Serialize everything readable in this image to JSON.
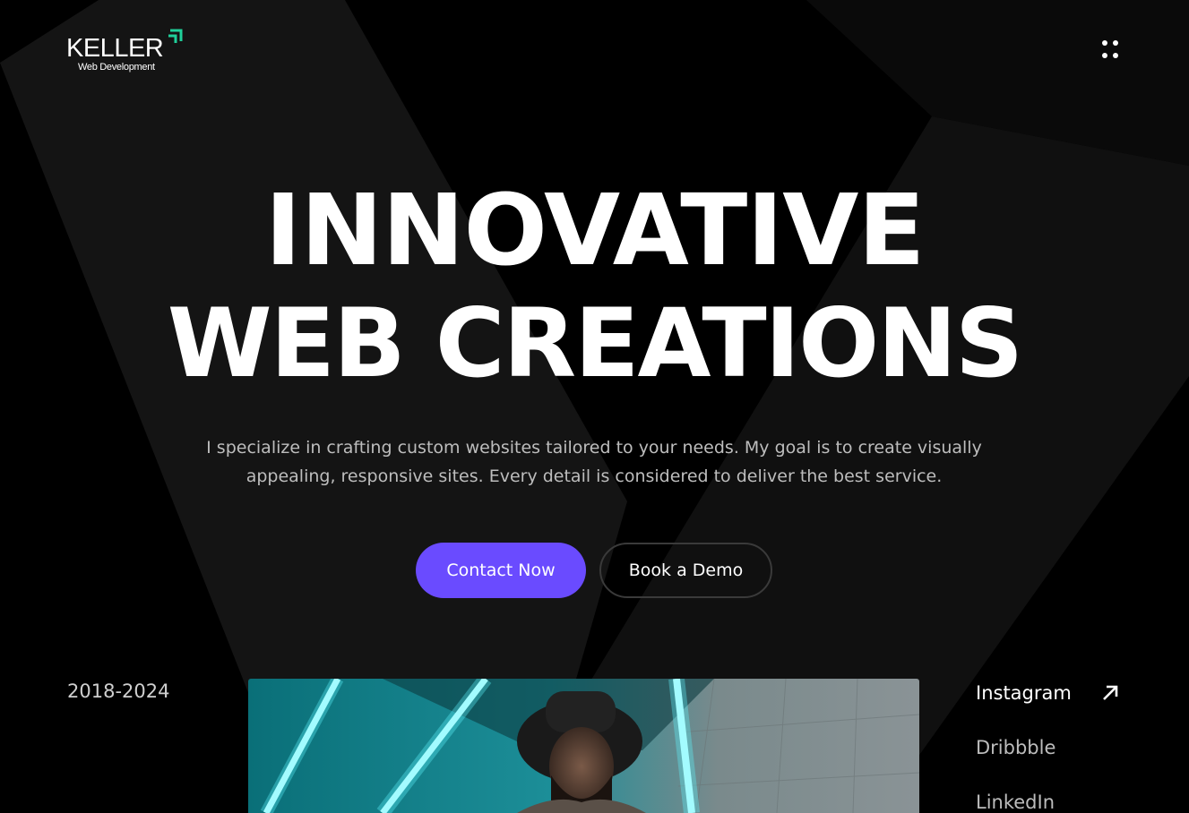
{
  "brand": {
    "name": "KELLER",
    "tagline": "Web Development",
    "accent_color": "#1fd09a"
  },
  "header": {
    "menu_icon": "grid-dots-icon"
  },
  "hero": {
    "title_line1": "INNOVATIVE",
    "title_line2": "WEB CREATIONS",
    "description_line1": "I specialize in crafting custom websites tailored to your needs. My goal is to create visually",
    "description_line2": "appealing, responsive sites. Every detail is considered to deliver the best service.",
    "primary_button": "Contact Now",
    "secondary_button": "Book a Demo",
    "primary_color": "#6a4bff"
  },
  "footer_row": {
    "years": "2018-2024",
    "socials": [
      {
        "label": "Instagram",
        "icon": "arrow-up-right-icon"
      },
      {
        "label": "Dribbble"
      },
      {
        "label": "LinkedIn"
      }
    ]
  }
}
